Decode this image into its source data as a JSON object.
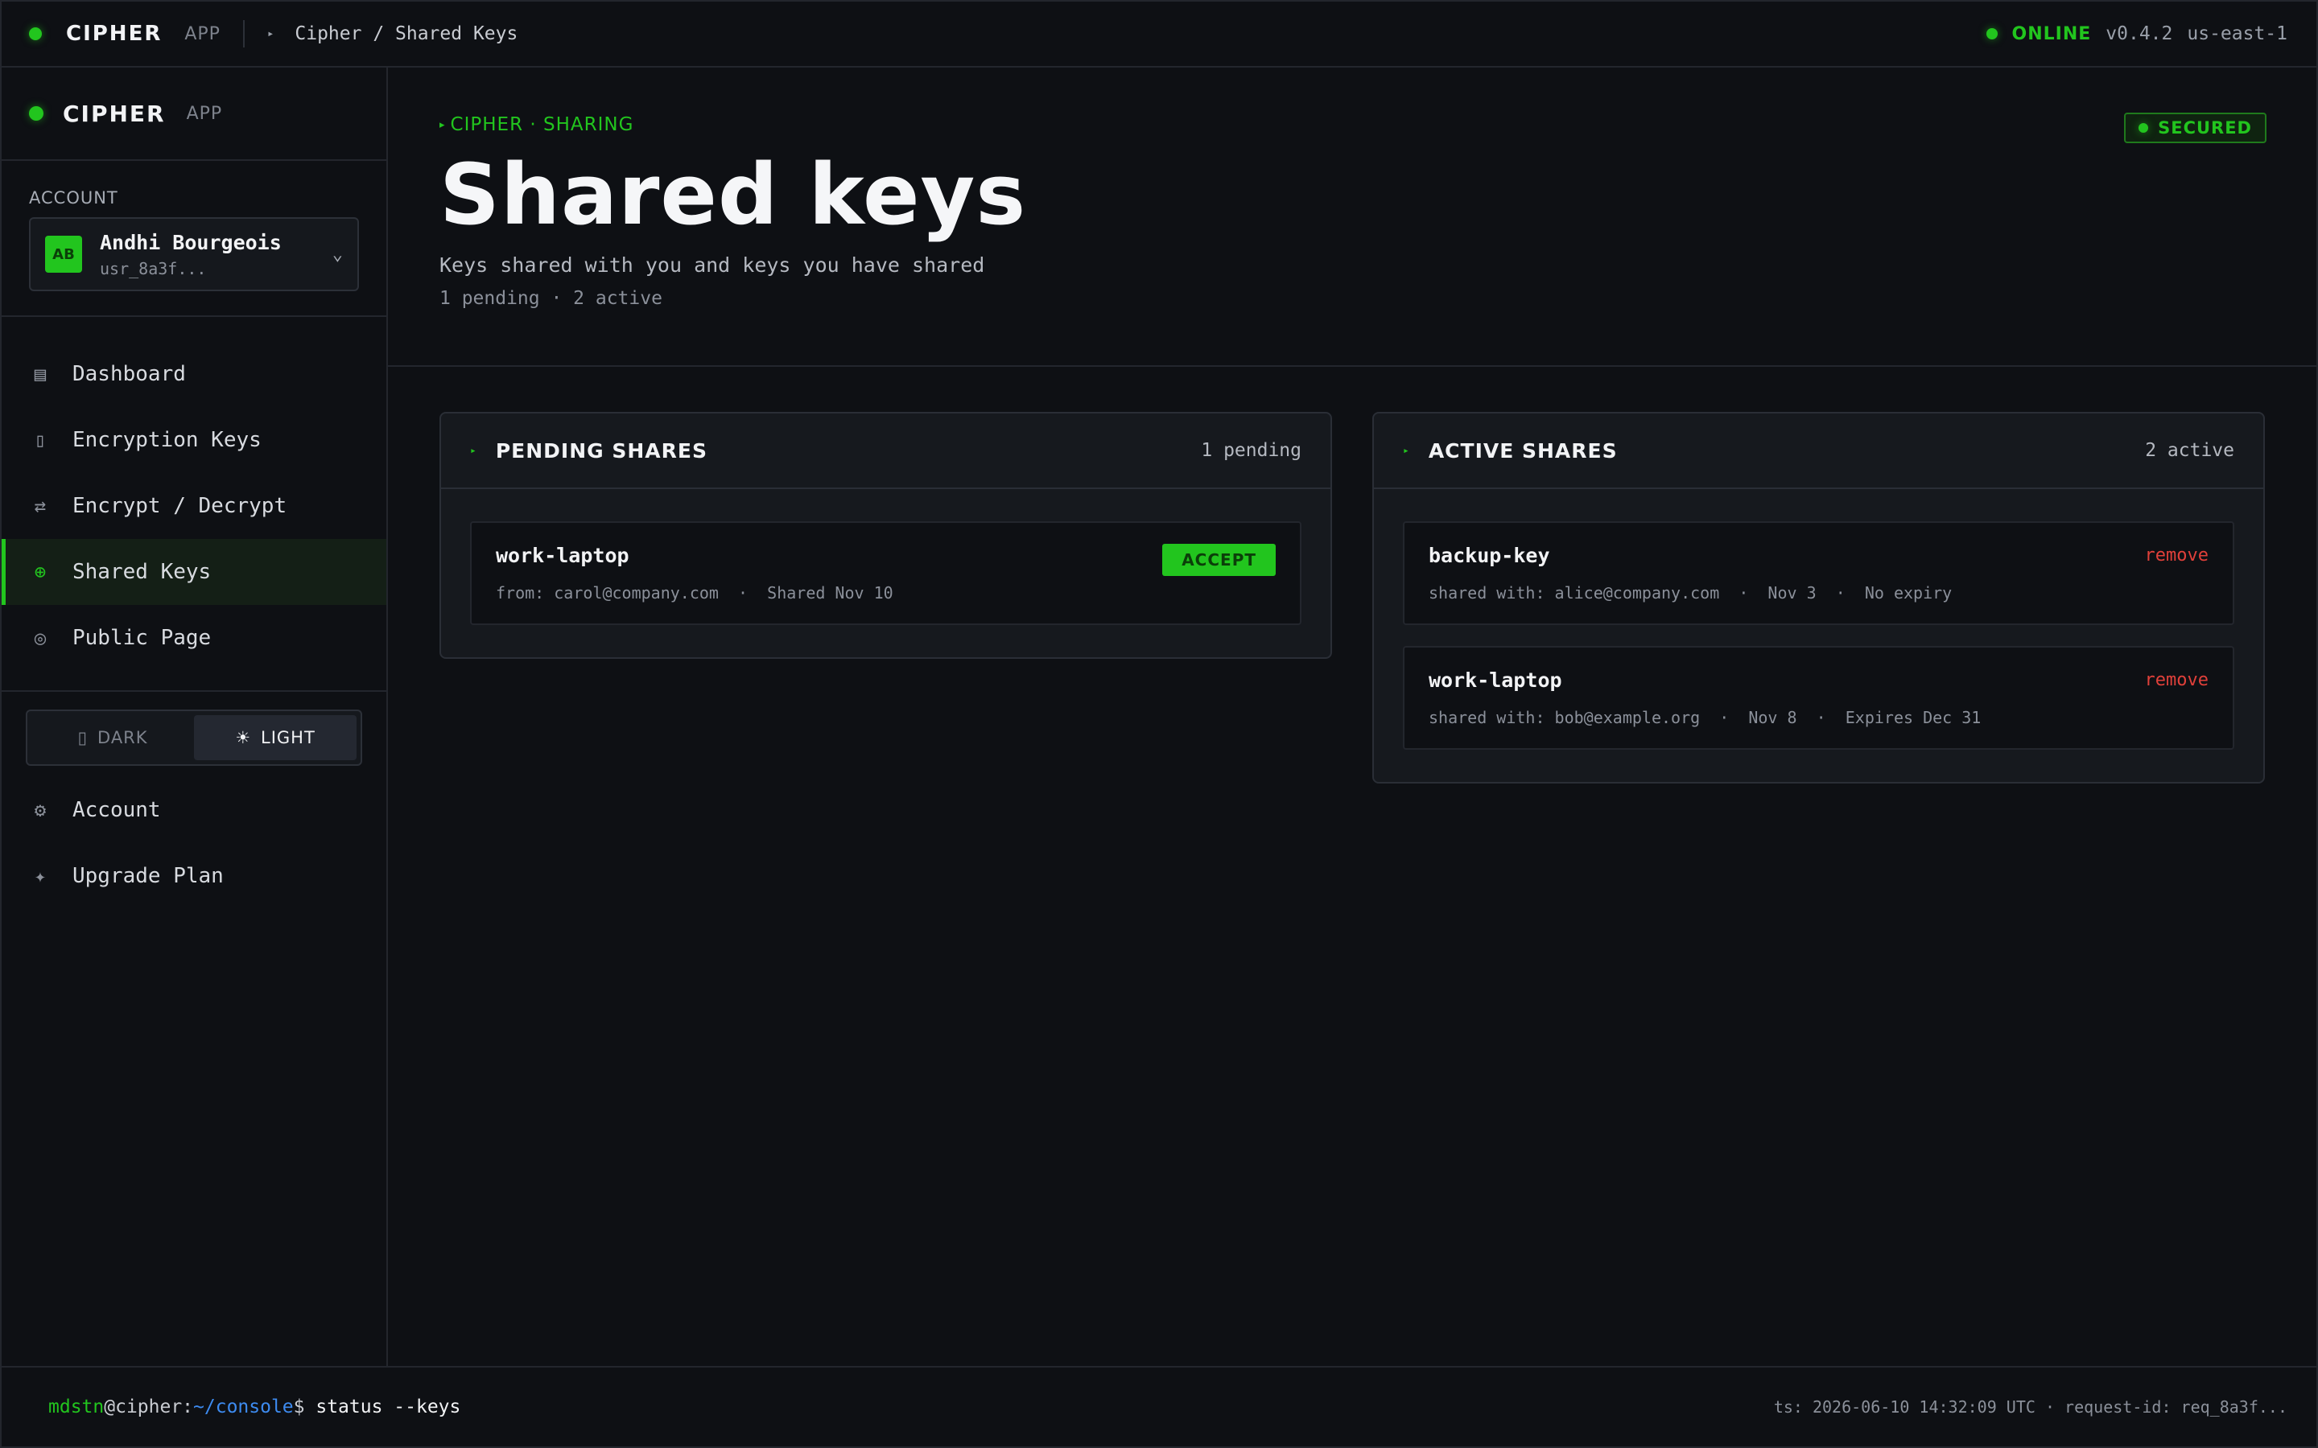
{
  "topbar": {
    "brand": "CIPHER",
    "brand_sub": "APP",
    "breadcrumb": "Cipher / Shared Keys",
    "status": "ONLINE",
    "version": "v0.4.2",
    "region": "us-east-1"
  },
  "sidebar": {
    "brand": "CIPHER",
    "brand_sub": "APP",
    "account_label": "ACCOUNT",
    "account": {
      "initials": "AB",
      "name": "Andhi Bourgeois",
      "id": "usr_8a3f..."
    },
    "nav": [
      {
        "label": "Dashboard",
        "icon": "dashboard-icon",
        "glyph": "▤"
      },
      {
        "label": "Encryption Keys",
        "icon": "key-icon",
        "glyph": "▯"
      },
      {
        "label": "Encrypt / Decrypt",
        "icon": "swap-icon",
        "glyph": "⇄"
      },
      {
        "label": "Shared Keys",
        "icon": "share-icon",
        "glyph": "⊕",
        "active": true
      },
      {
        "label": "Public Page",
        "icon": "globe-icon",
        "glyph": "◎"
      }
    ],
    "theme": {
      "dark": "DARK",
      "light": "LIGHT",
      "selected": "light"
    },
    "bottom_nav": [
      {
        "label": "Account",
        "icon": "gear-icon",
        "glyph": "⚙"
      },
      {
        "label": "Upgrade Plan",
        "icon": "sparkle-icon",
        "glyph": "✦"
      }
    ]
  },
  "hero": {
    "eyebrow": "CIPHER · SHARING",
    "title": "Shared keys",
    "subtitle": "Keys shared with you and keys you have shared",
    "meta": "1 pending · 2 active",
    "badge": "SECURED"
  },
  "pending": {
    "title": "PENDING SHARES",
    "count": "1 pending",
    "items": [
      {
        "name": "work-laptop",
        "meta": "from: carol@company.com  ·  Shared Nov 10",
        "action": "ACCEPT"
      }
    ]
  },
  "active": {
    "title": "ACTIVE SHARES",
    "count": "2 active",
    "items": [
      {
        "name": "backup-key",
        "meta": "shared with: alice@company.com  ·  Nov 3  ·  No expiry",
        "action": "remove"
      },
      {
        "name": "work-laptop",
        "meta": "shared with: bob@example.org  ·  Nov 8  ·  Expires Dec 31",
        "action": "remove"
      }
    ]
  },
  "footer": {
    "user": "mdstn",
    "host": "@cipher:",
    "path": "~/console",
    "prompt": "$ ",
    "command": "status --keys",
    "right": "ts: 2026-06-10 14:32:09 UTC · request-id: req_8a3f..."
  },
  "colors": {
    "accent": "#22c51e",
    "danger": "#e0403a",
    "link": "#3d8bf0",
    "background": "#0e1014"
  }
}
